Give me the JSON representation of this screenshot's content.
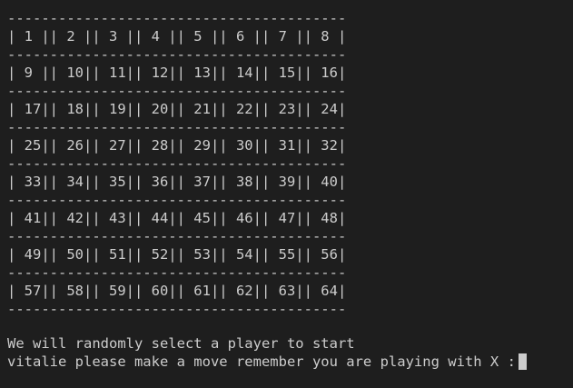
{
  "board": {
    "separator": "----------------------------------------",
    "rows": [
      "| 1 || 2 || 3 || 4 || 5 || 6 || 7 || 8 |",
      "| 9 || 10|| 11|| 12|| 13|| 14|| 15|| 16|",
      "| 17|| 18|| 19|| 20|| 21|| 22|| 23|| 24|",
      "| 25|| 26|| 27|| 28|| 29|| 30|| 31|| 32|",
      "| 33|| 34|| 35|| 36|| 37|| 38|| 39|| 40|",
      "| 41|| 42|| 43|| 44|| 45|| 46|| 47|| 48|",
      "| 49|| 50|| 51|| 52|| 53|| 54|| 55|| 56|",
      "| 57|| 58|| 59|| 60|| 61|| 62|| 63|| 64|"
    ]
  },
  "messages": {
    "line1": "We will randomly select a player to start",
    "line2": "vitalie please make a move remember you are playing with X :"
  },
  "colors": {
    "background": "#1e1e1e",
    "text": "#cccccc"
  }
}
